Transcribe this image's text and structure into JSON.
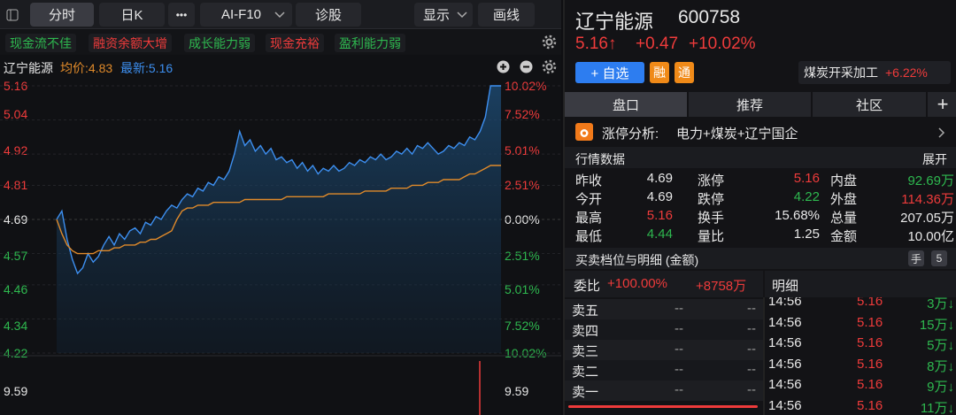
{
  "tabs": {
    "timeshare": "分时",
    "kline": "日K",
    "more": "•••",
    "ai_f10": "AI-F10",
    "diagnose": "诊股",
    "display": "显示",
    "draw": "画线"
  },
  "tags": [
    "现金流不佳",
    "融资余额大增",
    "成长能力弱",
    "现金充裕",
    "盈利能力弱"
  ],
  "chart_header": {
    "name": "辽宁能源",
    "avg_label": "均价:4.83",
    "latest_label": "最新:5.16"
  },
  "chart_data": {
    "type": "line",
    "price_ticks": [
      "5.16",
      "5.04",
      "4.92",
      "4.81",
      "4.69",
      "4.57",
      "4.46",
      "4.34",
      "4.22"
    ],
    "pct_ticks": [
      "10.02%",
      "7.52%",
      "5.01%",
      "2.51%",
      "0.00%",
      "2.51%",
      "5.01%",
      "7.52%",
      "10.02%"
    ],
    "ylim": [
      4.22,
      5.16
    ],
    "prev_close": 4.69,
    "series": [
      {
        "name": "最新",
        "color": "#3d8ff0",
        "values": [
          4.69,
          4.72,
          4.62,
          4.55,
          4.5,
          4.52,
          4.57,
          4.54,
          4.56,
          4.6,
          4.63,
          4.6,
          4.64,
          4.62,
          4.65,
          4.66,
          4.64,
          4.68,
          4.67,
          4.7,
          4.69,
          4.72,
          4.74,
          4.73,
          4.76,
          4.78,
          4.77,
          4.8,
          4.79,
          4.82,
          4.81,
          4.84,
          4.83,
          4.86,
          4.92,
          5.0,
          4.95,
          4.97,
          4.93,
          4.95,
          4.92,
          4.94,
          4.9,
          4.91,
          4.89,
          4.9,
          4.87,
          4.89,
          4.86,
          4.88,
          4.85,
          4.87,
          4.86,
          4.88,
          4.86,
          4.87,
          4.89,
          4.88,
          4.9,
          4.89,
          4.91,
          4.9,
          4.92,
          4.9,
          4.91,
          4.93,
          4.92,
          4.94,
          4.92,
          4.95,
          4.94,
          4.96,
          4.94,
          4.92,
          4.93,
          4.95,
          4.94,
          4.96,
          4.95,
          4.98,
          4.97,
          5.0,
          5.05,
          5.16,
          5.16,
          5.16
        ]
      },
      {
        "name": "均价",
        "color": "#e08a2a",
        "values": [
          4.69,
          4.64,
          4.6,
          4.58,
          4.57,
          4.57,
          4.57,
          4.57,
          4.58,
          4.58,
          4.58,
          4.59,
          4.59,
          4.6,
          4.6,
          4.6,
          4.61,
          4.61,
          4.62,
          4.62,
          4.63,
          4.64,
          4.65,
          4.69,
          4.72,
          4.73,
          4.73,
          4.74,
          4.74,
          4.74,
          4.75,
          4.75,
          4.75,
          4.75,
          4.75,
          4.75,
          4.76,
          4.76,
          4.76,
          4.76,
          4.76,
          4.76,
          4.76,
          4.76,
          4.77,
          4.77,
          4.77,
          4.77,
          4.77,
          4.77,
          4.77,
          4.77,
          4.78,
          4.78,
          4.78,
          4.78,
          4.78,
          4.78,
          4.78,
          4.79,
          4.79,
          4.79,
          4.79,
          4.79,
          4.8,
          4.8,
          4.8,
          4.8,
          4.81,
          4.81,
          4.81,
          4.82,
          4.82,
          4.82,
          4.83,
          4.83,
          4.83,
          4.83,
          4.84,
          4.85,
          4.85,
          4.86,
          4.87,
          4.88,
          4.88,
          4.88
        ]
      }
    ],
    "volume_label_left": "9.59",
    "volume_label_right": "9.59"
  },
  "stock": {
    "name": "辽宁能源",
    "code": "600758",
    "price": "5.16↑",
    "change": "+0.47",
    "change_pct": "+10.02%",
    "add_fav": "+ 自选",
    "rong": "融",
    "tong": "通",
    "sector_name": "煤炭开采加工",
    "sector_pct": "+6.22%"
  },
  "seg_tabs": [
    "盘口",
    "推荐",
    "社区"
  ],
  "limit_reason": {
    "label": "涨停分析:",
    "text": "电力+煤炭+辽宁国企"
  },
  "quote": {
    "title": "行情数据",
    "expand": "展开",
    "rows": [
      [
        {
          "k": "昨收",
          "v": "4.69",
          "c": "w"
        },
        {
          "k": "涨停",
          "v": "5.16",
          "c": "r"
        },
        {
          "k": "内盘",
          "v": "92.69万",
          "c": "g"
        }
      ],
      [
        {
          "k": "今开",
          "v": "4.69",
          "c": "w"
        },
        {
          "k": "跌停",
          "v": "4.22",
          "c": "g"
        },
        {
          "k": "外盘",
          "v": "114.36万",
          "c": "r"
        }
      ],
      [
        {
          "k": "最高",
          "v": "5.16",
          "c": "r"
        },
        {
          "k": "换手",
          "v": "15.68%",
          "c": "w"
        },
        {
          "k": "总量",
          "v": "207.05万",
          "c": "w"
        }
      ],
      [
        {
          "k": "最低",
          "v": "4.44",
          "c": "g"
        },
        {
          "k": "量比",
          "v": "1.25",
          "c": "w"
        },
        {
          "k": "金额",
          "v": "10.00亿",
          "c": "w"
        }
      ]
    ]
  },
  "orderbook": {
    "title": "买卖档位与明细 (金额)",
    "hand_icon": "手",
    "count": "5",
    "weibi_label": "委比",
    "weibi_pct": "+100.00%",
    "weibi_amount": "+8758万",
    "detail_label": "明细",
    "asks": [
      {
        "label": "卖五",
        "price": "--",
        "vol": "--"
      },
      {
        "label": "卖四",
        "price": "--",
        "vol": "--"
      },
      {
        "label": "卖三",
        "price": "--",
        "vol": "--"
      },
      {
        "label": "卖二",
        "price": "--",
        "vol": "--"
      },
      {
        "label": "卖一",
        "price": "--",
        "vol": "--"
      }
    ],
    "ticks": [
      {
        "time": "14:56",
        "price": "5.16",
        "vol": "3万↓"
      },
      {
        "time": "14:56",
        "price": "5.16",
        "vol": "15万↓"
      },
      {
        "time": "14:56",
        "price": "5.16",
        "vol": "5万↓"
      },
      {
        "time": "14:56",
        "price": "5.16",
        "vol": "8万↓"
      },
      {
        "time": "14:56",
        "price": "5.16",
        "vol": "9万↓"
      },
      {
        "time": "14:56",
        "price": "5.16",
        "vol": "11万↓"
      }
    ]
  }
}
